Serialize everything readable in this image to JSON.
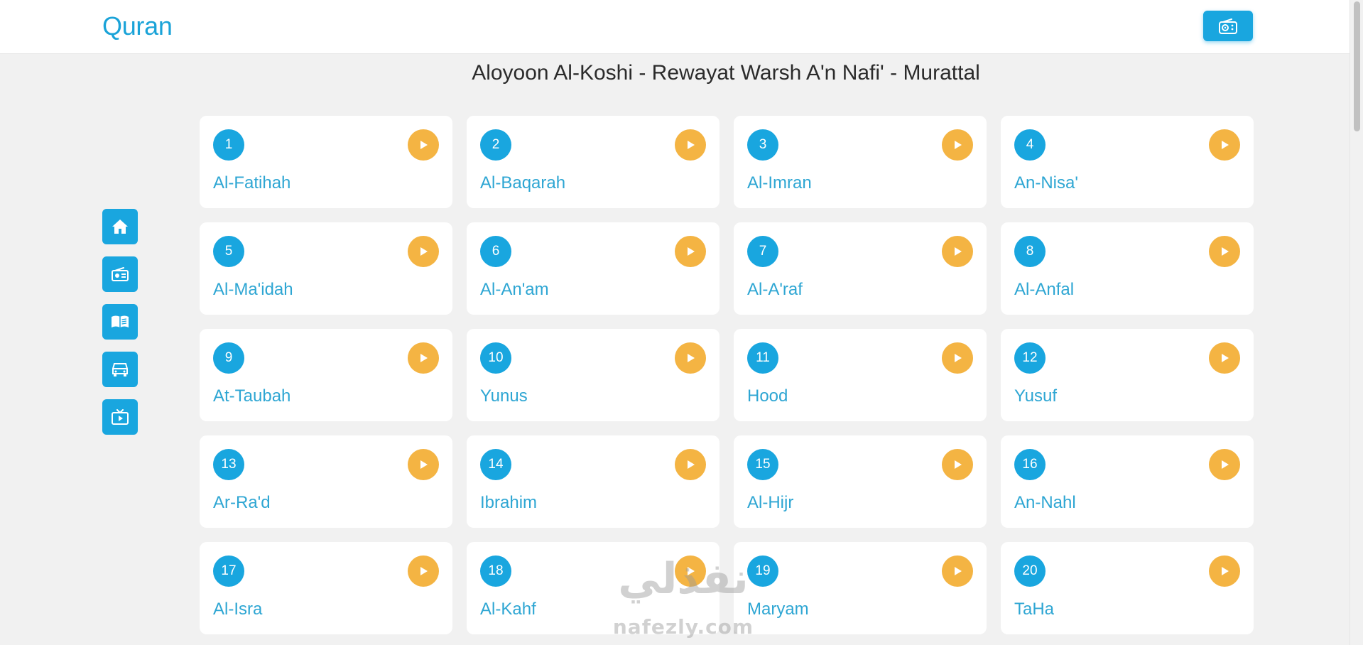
{
  "header": {
    "brand": "Quran",
    "radio_button_icon": "radio-icon"
  },
  "page_title": "Aloyoon Al-Koshi - Rewayat Warsh A'n Nafi' - Murattal",
  "side_nav": [
    {
      "icon": "home-icon"
    },
    {
      "icon": "radio-icon"
    },
    {
      "icon": "book-icon"
    },
    {
      "icon": "car-icon"
    },
    {
      "icon": "tv-icon"
    }
  ],
  "surahs": [
    {
      "number": "1",
      "name": "Al-Fatihah"
    },
    {
      "number": "2",
      "name": "Al-Baqarah"
    },
    {
      "number": "3",
      "name": "Al-Imran"
    },
    {
      "number": "4",
      "name": "An-Nisa'"
    },
    {
      "number": "5",
      "name": "Al-Ma'idah"
    },
    {
      "number": "6",
      "name": "Al-An'am"
    },
    {
      "number": "7",
      "name": "Al-A'raf"
    },
    {
      "number": "8",
      "name": "Al-Anfal"
    },
    {
      "number": "9",
      "name": "At-Taubah"
    },
    {
      "number": "10",
      "name": "Yunus"
    },
    {
      "number": "11",
      "name": "Hood"
    },
    {
      "number": "12",
      "name": "Yusuf"
    },
    {
      "number": "13",
      "name": "Ar-Ra'd"
    },
    {
      "number": "14",
      "name": "Ibrahim"
    },
    {
      "number": "15",
      "name": "Al-Hijr"
    },
    {
      "number": "16",
      "name": "An-Nahl"
    },
    {
      "number": "17",
      "name": "Al-Isra"
    },
    {
      "number": "18",
      "name": "Al-Kahf"
    },
    {
      "number": "19",
      "name": "Maryam"
    },
    {
      "number": "20",
      "name": "TaHa"
    }
  ],
  "watermark": {
    "arabic": "نفذلي",
    "latin": "nafezly.com"
  },
  "colors": {
    "primary": "#19a6df",
    "play": "#f4b443",
    "background": "#f1f1f1",
    "card": "#ffffff"
  }
}
